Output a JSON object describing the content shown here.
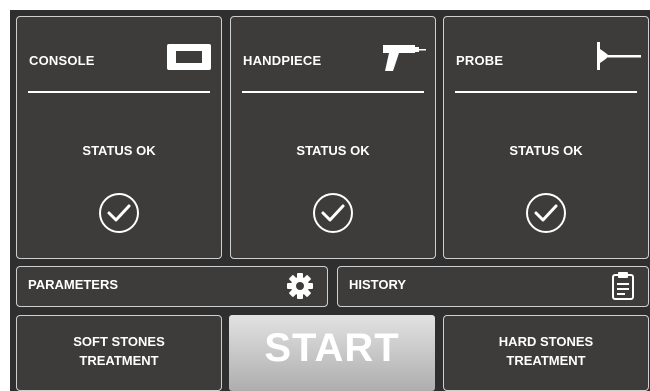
{
  "cards": [
    {
      "title": "CONSOLE",
      "icon": "console-icon",
      "status": "STATUS OK",
      "status_icon": "check-circle-icon"
    },
    {
      "title": "HANDPIECE",
      "icon": "handpiece-icon",
      "status": "STATUS OK",
      "status_icon": "check-circle-icon"
    },
    {
      "title": "PROBE",
      "icon": "probe-icon",
      "status": "STATUS OK",
      "status_icon": "check-circle-icon"
    }
  ],
  "parameters": {
    "label": "PARAMETERS",
    "icon": "gear-icon"
  },
  "history": {
    "label": "HISTORY",
    "icon": "clipboard-icon"
  },
  "soft_stones": {
    "line1": "SOFT STONES",
    "line2": "TREATMENT"
  },
  "start": {
    "label": "START"
  },
  "hard_stones": {
    "line1": "HARD STONES",
    "line2": "TREATMENT"
  },
  "colors": {
    "background": "#2f2f2f",
    "panel": "#3d3c3a",
    "border": "#cfcfcf",
    "text": "#ffffff"
  }
}
